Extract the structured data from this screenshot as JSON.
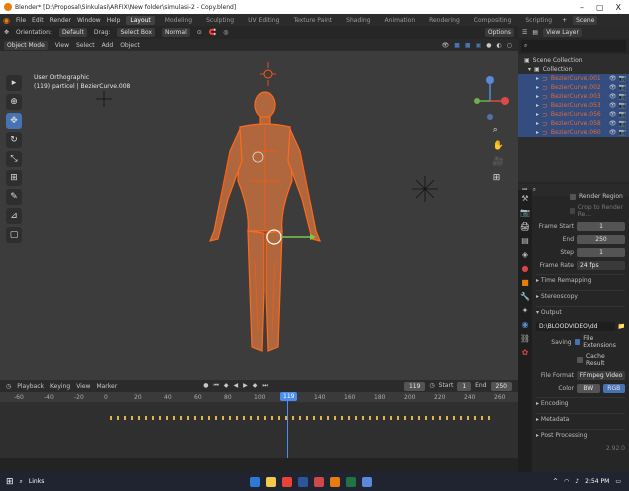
{
  "titlebar": {
    "title": "Blender* [D:\\Proposal\\Sinkulasi\\ARFIX\\New folder\\simulasi-2 - Copy.blend]",
    "minimize": "–",
    "maximize": "▢",
    "close": "X"
  },
  "menu": {
    "items": [
      "File",
      "Edit",
      "Render",
      "Window",
      "Help"
    ],
    "workspaces": [
      "Layout",
      "Modeling",
      "Sculpting",
      "UV Editing",
      "Texture Paint",
      "Shading",
      "Animation",
      "Rendering",
      "Compositing",
      "Scripting"
    ],
    "active_workspace": "Layout",
    "scene": "Scene",
    "view_layer": "View Layer"
  },
  "viewport_toolbar": {
    "orientation_label": "Orientation:",
    "orientation": "Default",
    "drag_label": "Drag:",
    "drag": "Select Box",
    "transform": "Normal",
    "options": "Options"
  },
  "viewport_header": {
    "mode": "Object Mode",
    "menus": [
      "View",
      "Select",
      "Add",
      "Object"
    ]
  },
  "viewport": {
    "view_name": "User Orthographic",
    "object_info": "(119) particel | BezierCurve.008",
    "gizmo": {
      "z": "Z",
      "y": "Y",
      "x": "X"
    }
  },
  "timeline_header": {
    "menus": [
      "Playback",
      "Keying",
      "View",
      "Marker"
    ],
    "current": "119",
    "start_label": "Start",
    "start": "1",
    "end_label": "End",
    "end": "250"
  },
  "timeline": {
    "ticks": [
      "-60",
      "-40",
      "-20",
      "0",
      "20",
      "40",
      "60",
      "80",
      "100",
      "120",
      "140",
      "160",
      "180",
      "200",
      "220",
      "240",
      "260"
    ],
    "cursor": "119"
  },
  "outliner": {
    "search_placeholder": "",
    "scene_collection": "Scene Collection",
    "collection": "Collection",
    "items": [
      "BezierCurve.001",
      "BezierCurve.002",
      "BezierCurve.003",
      "BezierCurve.053",
      "BezierCurve.056",
      "BezierCurve.058",
      "BezierCurve.060"
    ]
  },
  "properties": {
    "render_region": "Render Region",
    "crop": "Crop to Render Re...",
    "frame_start_label": "Frame Start",
    "frame_start": "1",
    "end_label": "End",
    "end": "250",
    "step_label": "Step",
    "step": "1",
    "frame_rate_label": "Frame Rate",
    "frame_rate": "24 fps",
    "time_remapping": "Time Remapping",
    "stereoscopy": "Stereoscopy",
    "output": "Output",
    "output_path": "D:\\BLOODVIDEO\\dd",
    "saving_label": "Saving",
    "file_extensions": "File Extensions",
    "cache_result": "Cache Result",
    "file_format_label": "File Format",
    "file_format": "FFmpeg Video",
    "color_label": "Color",
    "color_bw": "BW",
    "color_rgb": "RGB",
    "encoding": "Encoding",
    "metadata": "Metadata",
    "post_processing": "Post Processing"
  },
  "statusbar": {
    "version": "2.92.0"
  },
  "taskbar": {
    "search": "Links",
    "time": "2:54 PM"
  }
}
